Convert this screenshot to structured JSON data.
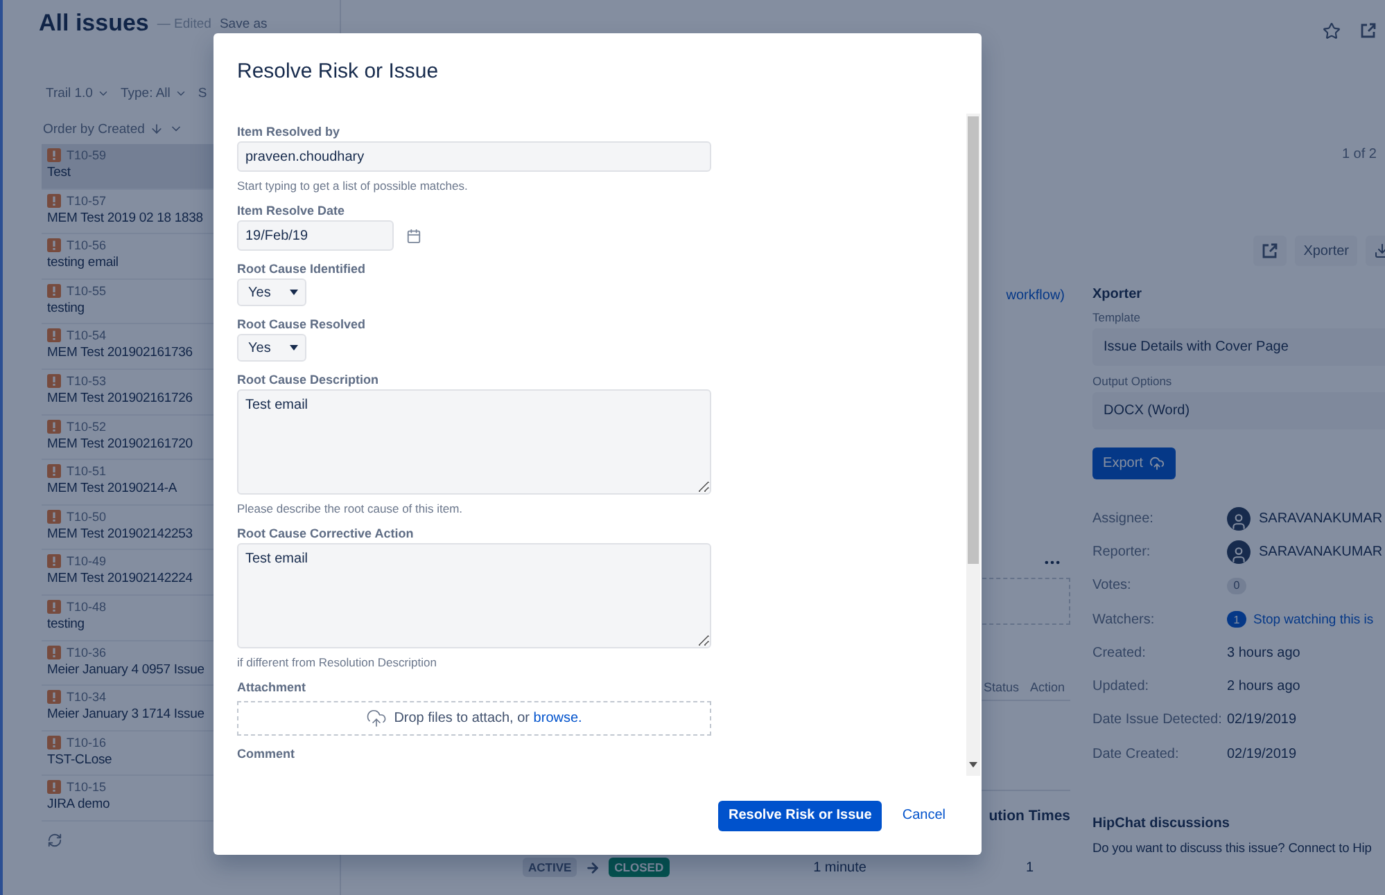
{
  "header": {
    "title": "All issues",
    "status": "— Edited",
    "save": "Save as"
  },
  "filters": [
    "Trail 1.0",
    "Type: All",
    "S"
  ],
  "order": "Order by Created",
  "issues": [
    {
      "key": "T10-59",
      "summary": "Test",
      "selected": true
    },
    {
      "key": "T10-57",
      "summary": "MEM Test 2019 02 18 1838",
      "selected": false
    },
    {
      "key": "T10-56",
      "summary": "testing email",
      "selected": false
    },
    {
      "key": "T10-55",
      "summary": "testing",
      "selected": false
    },
    {
      "key": "T10-54",
      "summary": "MEM Test 201902161736",
      "selected": false
    },
    {
      "key": "T10-53",
      "summary": "MEM Test 201902161726",
      "selected": false
    },
    {
      "key": "T10-52",
      "summary": "MEM Test 201902161720",
      "selected": false
    },
    {
      "key": "T10-51",
      "summary": "MEM Test 20190214-A",
      "selected": false
    },
    {
      "key": "T10-50",
      "summary": "MEM Test 201902142253",
      "selected": false
    },
    {
      "key": "T10-49",
      "summary": "MEM Test 201902142224",
      "selected": false
    },
    {
      "key": "T10-48",
      "summary": "testing",
      "selected": false
    },
    {
      "key": "T10-36",
      "summary": "Meier January 4 0957 Issue",
      "selected": false
    },
    {
      "key": "T10-34",
      "summary": "Meier January 3 1714 Issue",
      "selected": false
    },
    {
      "key": "T10-16",
      "summary": "TST-CLose",
      "selected": false
    },
    {
      "key": "T10-15",
      "summary": "JIRA demo",
      "selected": false
    }
  ],
  "pager": "1 of 2",
  "middle": {
    "workflow_link": "workflow)",
    "columns": [
      "Status",
      "Action"
    ],
    "section_title": "ution Times",
    "transition": {
      "from": {
        "text": "ACTIVE",
        "kind": "default"
      },
      "to": {
        "text": "CLOSED",
        "kind": "success"
      },
      "time": "1 minute",
      "count": "1"
    }
  },
  "toolbar": {
    "xporter": "Xporter"
  },
  "xporter": {
    "title": "Xporter",
    "template_label": "Template",
    "template": "Issue Details with Cover Page",
    "output_label": "Output Options",
    "output": "DOCX (Word)",
    "export": "Export"
  },
  "details": [
    {
      "label": "Assignee:",
      "kind": "user",
      "value": "SARAVANAKUMAR"
    },
    {
      "label": "Reporter:",
      "kind": "user",
      "value": "SARAVANAKUMAR"
    },
    {
      "label": "Votes:",
      "kind": "count",
      "value": "0"
    },
    {
      "label": "Watchers:",
      "kind": "watch",
      "count": "1",
      "value": "Stop watching this is"
    },
    {
      "label": "Created:",
      "kind": "text",
      "value": "3 hours ago"
    },
    {
      "label": "Updated:",
      "kind": "text",
      "value": "2 hours ago"
    },
    {
      "label": "Date Issue Detected:",
      "kind": "text",
      "value": "02/19/2019"
    },
    {
      "label": "Date Created:",
      "kind": "text",
      "value": "02/19/2019"
    }
  ],
  "hipchat": {
    "title": "HipChat discussions",
    "text": "Do you want to discuss this issue? Connect to Hip"
  },
  "dialog": {
    "title": "Resolve Risk or Issue",
    "fields": [
      {
        "kind": "text",
        "label": "Item Resolved by",
        "value": "praveen.choudhary",
        "hint": "Start typing to get a list of possible matches."
      },
      {
        "kind": "date",
        "label": "Item Resolve Date",
        "value": "19/Feb/19"
      },
      {
        "kind": "select",
        "label": "Root Cause Identified",
        "value": "Yes"
      },
      {
        "kind": "select",
        "label": "Root Cause Resolved",
        "value": "Yes"
      },
      {
        "kind": "textarea",
        "label": "Root Cause Description",
        "value": "Test email",
        "hint": "Please describe the root cause of this item."
      },
      {
        "kind": "textarea",
        "label": "Root Cause Corrective Action",
        "value": "Test email",
        "hint": "if different from Resolution Description"
      },
      {
        "kind": "dropzone",
        "label": "Attachment",
        "text": "Drop files to attach, or",
        "link": "browse."
      },
      {
        "kind": "label",
        "label": "Comment"
      }
    ],
    "submit": "Resolve Risk or Issue",
    "cancel": "Cancel"
  }
}
